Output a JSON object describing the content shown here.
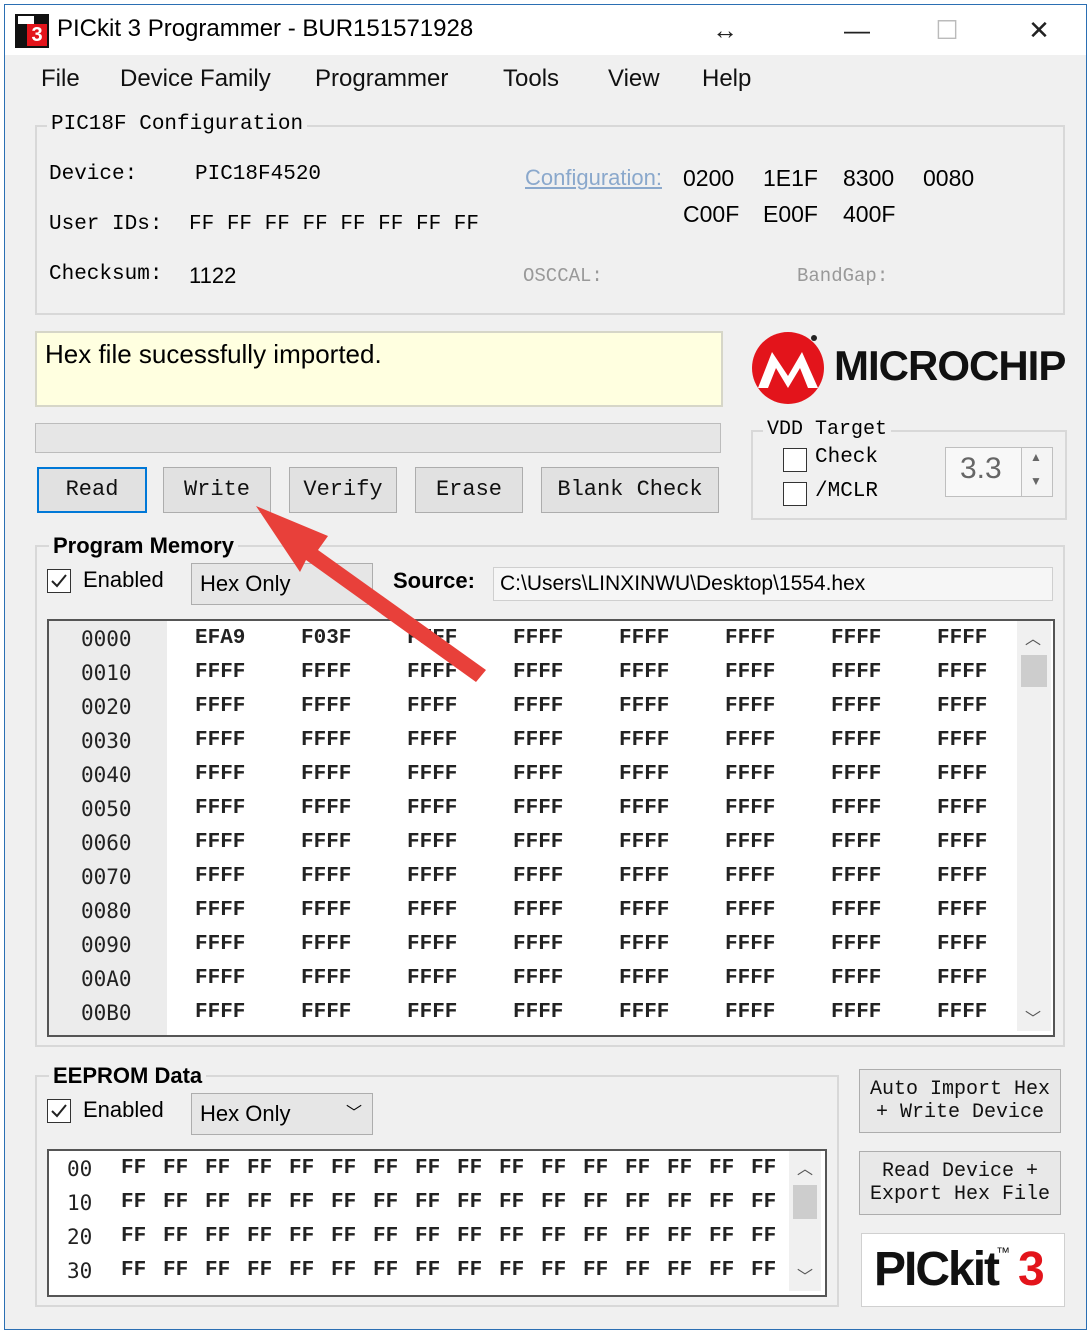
{
  "window": {
    "title": "PICkit 3 Programmer - BUR151571928",
    "controls": {
      "restore": "↔",
      "minimize": "—",
      "maximize": "☐",
      "close": "✕"
    }
  },
  "menu": [
    "File",
    "Device Family",
    "Programmer",
    "Tools",
    "View",
    "Help"
  ],
  "config": {
    "legend": "PIC18F Configuration",
    "device_label": "Device:",
    "device_value": "PIC18F4520",
    "userids_label": "User IDs:",
    "userids_value": [
      "FF",
      "FF",
      "FF",
      "FF",
      "FF",
      "FF",
      "FF",
      "FF"
    ],
    "checksum_label": "Checksum:",
    "checksum_value": "1122",
    "configuration_link": "Configuration:",
    "config_words": [
      [
        "0200",
        "1E1F",
        "8300",
        "0080"
      ],
      [
        "C00F",
        "E00F",
        "400F"
      ]
    ],
    "osccal_label": "OSCCAL:",
    "bandgap_label": "BandGap:"
  },
  "status": {
    "message": "Hex file sucessfully imported."
  },
  "progress": 0,
  "buttons": {
    "read": "Read",
    "write": "Write",
    "verify": "Verify",
    "erase": "Erase",
    "blank_check": "Blank Check"
  },
  "microchip_logo_text": "MICROCHIP",
  "vdd": {
    "legend": "VDD Target",
    "check_label": "Check",
    "mclr_label": "/MCLR",
    "value": "3.3",
    "check_checked": false,
    "mclr_checked": false
  },
  "program_memory": {
    "legend": "Program Memory",
    "enabled_label": "Enabled",
    "enabled_checked": true,
    "mode": "Hex Only",
    "source_label": "Source:",
    "source_value": "C:\\Users\\LINXINWU\\Desktop\\1554.hex",
    "rows": [
      {
        "addr": "0000",
        "words": [
          "EFA9",
          "F03F",
          "FFFF",
          "FFFF",
          "FFFF",
          "FFFF",
          "FFFF",
          "FFFF"
        ]
      },
      {
        "addr": "0010",
        "words": [
          "FFFF",
          "FFFF",
          "FFFF",
          "FFFF",
          "FFFF",
          "FFFF",
          "FFFF",
          "FFFF"
        ]
      },
      {
        "addr": "0020",
        "words": [
          "FFFF",
          "FFFF",
          "FFFF",
          "FFFF",
          "FFFF",
          "FFFF",
          "FFFF",
          "FFFF"
        ]
      },
      {
        "addr": "0030",
        "words": [
          "FFFF",
          "FFFF",
          "FFFF",
          "FFFF",
          "FFFF",
          "FFFF",
          "FFFF",
          "FFFF"
        ]
      },
      {
        "addr": "0040",
        "words": [
          "FFFF",
          "FFFF",
          "FFFF",
          "FFFF",
          "FFFF",
          "FFFF",
          "FFFF",
          "FFFF"
        ]
      },
      {
        "addr": "0050",
        "words": [
          "FFFF",
          "FFFF",
          "FFFF",
          "FFFF",
          "FFFF",
          "FFFF",
          "FFFF",
          "FFFF"
        ]
      },
      {
        "addr": "0060",
        "words": [
          "FFFF",
          "FFFF",
          "FFFF",
          "FFFF",
          "FFFF",
          "FFFF",
          "FFFF",
          "FFFF"
        ]
      },
      {
        "addr": "0070",
        "words": [
          "FFFF",
          "FFFF",
          "FFFF",
          "FFFF",
          "FFFF",
          "FFFF",
          "FFFF",
          "FFFF"
        ]
      },
      {
        "addr": "0080",
        "words": [
          "FFFF",
          "FFFF",
          "FFFF",
          "FFFF",
          "FFFF",
          "FFFF",
          "FFFF",
          "FFFF"
        ]
      },
      {
        "addr": "0090",
        "words": [
          "FFFF",
          "FFFF",
          "FFFF",
          "FFFF",
          "FFFF",
          "FFFF",
          "FFFF",
          "FFFF"
        ]
      },
      {
        "addr": "00A0",
        "words": [
          "FFFF",
          "FFFF",
          "FFFF",
          "FFFF",
          "FFFF",
          "FFFF",
          "FFFF",
          "FFFF"
        ]
      },
      {
        "addr": "00B0",
        "words": [
          "FFFF",
          "FFFF",
          "FFFF",
          "FFFF",
          "FFFF",
          "FFFF",
          "FFFF",
          "FFFF"
        ]
      }
    ]
  },
  "eeprom": {
    "legend": "EEPROM Data",
    "enabled_label": "Enabled",
    "enabled_checked": true,
    "mode": "Hex Only",
    "rows": [
      {
        "addr": "00",
        "bytes": [
          "FF",
          "FF",
          "FF",
          "FF",
          "FF",
          "FF",
          "FF",
          "FF",
          "FF",
          "FF",
          "FF",
          "FF",
          "FF",
          "FF",
          "FF",
          "FF"
        ]
      },
      {
        "addr": "10",
        "bytes": [
          "FF",
          "FF",
          "FF",
          "FF",
          "FF",
          "FF",
          "FF",
          "FF",
          "FF",
          "FF",
          "FF",
          "FF",
          "FF",
          "FF",
          "FF",
          "FF"
        ]
      },
      {
        "addr": "20",
        "bytes": [
          "FF",
          "FF",
          "FF",
          "FF",
          "FF",
          "FF",
          "FF",
          "FF",
          "FF",
          "FF",
          "FF",
          "FF",
          "FF",
          "FF",
          "FF",
          "FF"
        ]
      },
      {
        "addr": "30",
        "bytes": [
          "FF",
          "FF",
          "FF",
          "FF",
          "FF",
          "FF",
          "FF",
          "FF",
          "FF",
          "FF",
          "FF",
          "FF",
          "FF",
          "FF",
          "FF",
          "FF"
        ]
      }
    ]
  },
  "side_buttons": {
    "auto_import_line1": "Auto Import Hex",
    "auto_import_line2": "+ Write Device",
    "read_export_line1": "Read Device +",
    "read_export_line2": "Export Hex File"
  },
  "pickit_logo": {
    "text": "PICkit",
    "tm": "™",
    "num": "3"
  },
  "colors": {
    "accent_blue": "#0078d7",
    "status_bg": "#ffffe0",
    "arrow_red": "#e8403a",
    "microchip_red": "#e3141b"
  }
}
